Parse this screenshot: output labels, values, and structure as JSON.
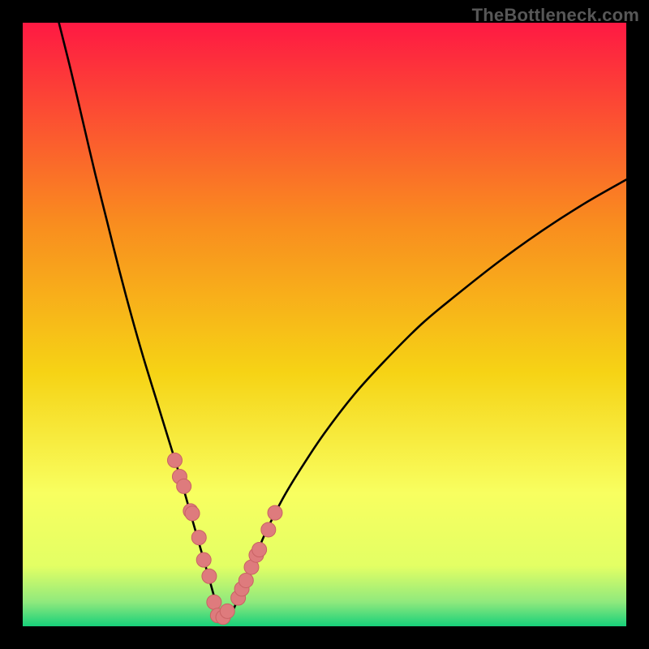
{
  "watermark": "TheBottleneck.com",
  "colors": {
    "frame_bg": "#000000",
    "watermark_text": "#575757",
    "curve": "#000000",
    "marker_fill": "#de7b7d",
    "marker_stroke": "#c96264",
    "gradient_top": "#fe1943",
    "gradient_upper_mid": "#f98c1f",
    "gradient_mid": "#f6d315",
    "gradient_band": "#f8ff60",
    "gradient_band_lower": "#e3ff64",
    "gradient_cool": "#8fe97d",
    "gradient_bottom": "#17d07a"
  },
  "chart_data": {
    "type": "line",
    "title": "",
    "xlabel": "",
    "ylabel": "",
    "xlim": [
      0,
      100
    ],
    "ylim": [
      0,
      100
    ],
    "grid": false,
    "legend": false,
    "optimum_x": 32.5,
    "series": [
      {
        "name": "bottleneck-curve",
        "x": [
          6,
          8,
          10,
          12,
          14,
          16,
          18,
          20,
          22,
          24,
          26,
          28,
          30,
          31,
          32,
          33,
          34,
          35,
          36,
          38,
          40,
          43,
          46,
          50,
          55,
          60,
          66,
          72,
          79,
          86,
          93,
          100
        ],
        "y": [
          100,
          92,
          83.5,
          75,
          67,
          59,
          51.5,
          44.5,
          38,
          31.5,
          25,
          18,
          11,
          7.5,
          4,
          1.5,
          1.5,
          3,
          5.5,
          10,
          15,
          21,
          26,
          32,
          38.5,
          44,
          50,
          55,
          60.5,
          65.5,
          70,
          74
        ]
      }
    ],
    "markers": {
      "name": "highlighted-points",
      "x": [
        25.2,
        26.0,
        26.7,
        27.8,
        28.1,
        29.2,
        30.0,
        30.9,
        31.7,
        32.3,
        33.2,
        33.9,
        35.7,
        36.3,
        37.0,
        37.9,
        38.7,
        39.2,
        40.7,
        41.8
      ],
      "y": [
        27.5,
        24.8,
        23.2,
        19.1,
        18.7,
        14.7,
        11.0,
        8.3,
        4.0,
        1.8,
        1.5,
        2.5,
        4.7,
        6.2,
        7.6,
        9.8,
        11.8,
        12.7,
        16.0,
        18.8
      ]
    }
  }
}
